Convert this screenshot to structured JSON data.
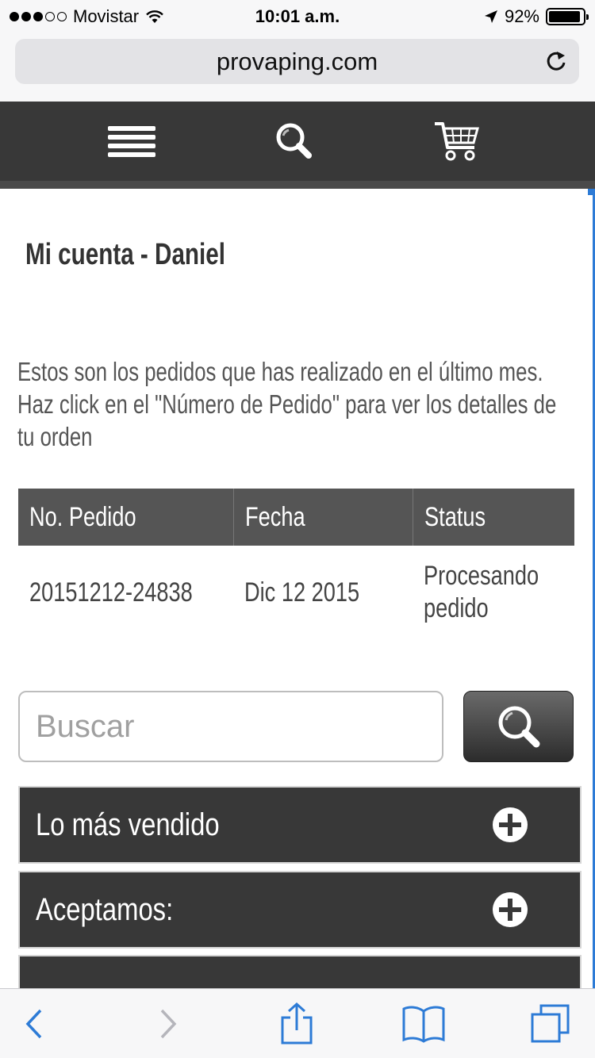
{
  "status_bar": {
    "carrier": "Movistar",
    "time": "10:01 a.m.",
    "battery_percent": "92%",
    "battery_level": 0.92,
    "signal_bars_filled": 3,
    "signal_bars_total": 5
  },
  "browser": {
    "url": "provaping.com"
  },
  "header": {
    "icons": [
      "hamburger-menu-icon",
      "search-icon",
      "cart-icon"
    ]
  },
  "page": {
    "title": "Mi cuenta - Daniel",
    "intro": "Estos son los pedidos que has realizado en el último mes. Haz click en el \"Número de Pedido\" para ver los detalles de tu orden"
  },
  "orders_table": {
    "headers": [
      "No. Pedido",
      "Fecha",
      "Status"
    ],
    "rows": [
      {
        "order_number": "20151212-24838",
        "date": "Dic 12 2015",
        "status": "Procesando pedido"
      }
    ]
  },
  "search": {
    "placeholder": "Buscar"
  },
  "accordions": [
    {
      "label": "Lo más vendido"
    },
    {
      "label": "Aceptamos:"
    }
  ],
  "colors": {
    "header_bg": "#383838",
    "table_header_bg": "#555555",
    "accordion_bg": "#383838",
    "ios_blue": "#2d7bd6"
  }
}
